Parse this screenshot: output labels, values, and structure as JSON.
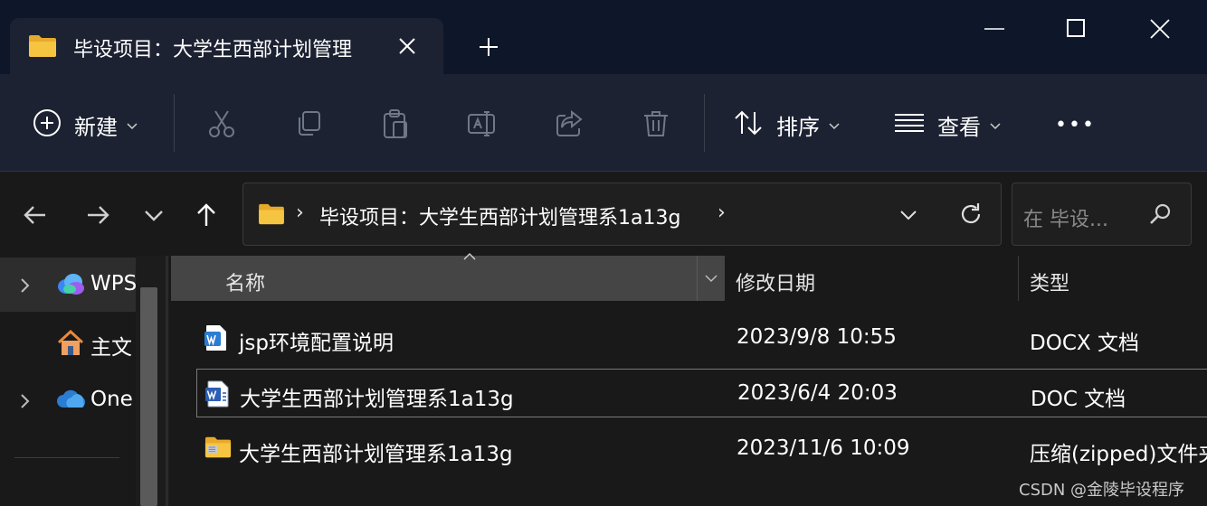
{
  "tab": {
    "title": "毕设项目：大学生西部计划管理",
    "folder_icon": "folder-icon",
    "close_icon": "close-icon"
  },
  "new_tab_icon": "plus-icon",
  "window_controls": [
    "minimize-icon",
    "maximize-icon",
    "close-icon"
  ],
  "toolbar": {
    "new_label": "新建",
    "sort_label": "排序",
    "view_label": "查看",
    "more_label": "•••",
    "icons": [
      "new-icon",
      "cut-icon",
      "copy-icon",
      "paste-icon",
      "rename-icon",
      "share-icon",
      "delete-icon",
      "sort-icon",
      "view-icon"
    ]
  },
  "nav": {
    "back_icon": "back-arrow-icon",
    "forward_icon": "forward-arrow-icon",
    "recent_icon": "chevron-down-icon",
    "up_icon": "up-arrow-icon"
  },
  "address": {
    "path": "毕设项目：大学生西部计划管理系1a13g",
    "separator": "›"
  },
  "search": {
    "placeholder": "在 毕设..."
  },
  "sidebar": {
    "items": [
      {
        "label": "WPS",
        "icon": "wps-cloud-icon",
        "expandable": true
      },
      {
        "label": "主文",
        "icon": "home-icon",
        "expandable": false
      },
      {
        "label": "One",
        "icon": "onedrive-icon",
        "expandable": true
      }
    ]
  },
  "columns": {
    "name": "名称",
    "date": "修改日期",
    "type": "类型",
    "sort_indicator": "^"
  },
  "files": [
    {
      "name": "jsp环境配置说明",
      "date": "2023/9/8 10:55",
      "type": "DOCX 文档",
      "icon": "wps-word-icon"
    },
    {
      "name": "大学生西部计划管理系1a13g",
      "date": "2023/6/4 20:03",
      "type": "DOC 文档",
      "icon": "word-doc-icon"
    },
    {
      "name": "大学生西部计划管理系1a13g",
      "date": "2023/11/6 10:09",
      "type": "压缩(zipped)文件夹",
      "icon": "zip-folder-icon"
    }
  ],
  "watermark": "CSDN @金陵毕设程序",
  "colors": {
    "titlebar": "#0e1729",
    "commandbar": "#1c2232",
    "background": "#191919",
    "folder": "#f5c441",
    "accent": "#3b86f0"
  }
}
